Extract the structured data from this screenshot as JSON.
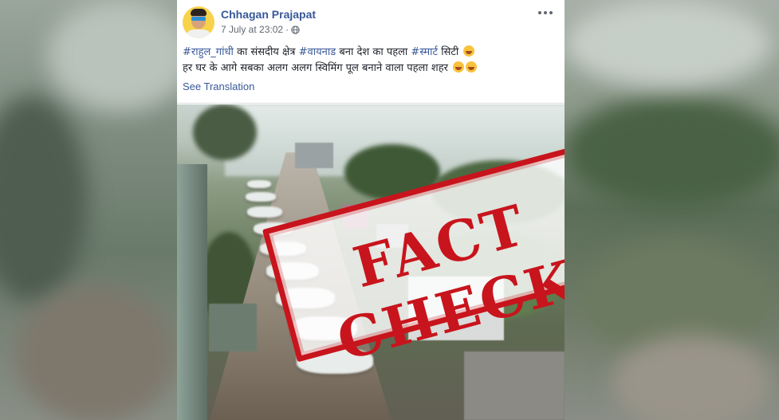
{
  "post": {
    "author": "Chhagan Prajapat",
    "timestamp": "7 July at 23:02",
    "text": {
      "tag1": "#राहुल_गांधी",
      "segment1": " का संसदीय क्षेत्र ",
      "tag2": "#वायनाड",
      "segment2": " बना देश का पहला ",
      "tag3": "#स्मार्ट",
      "segment3": " सिटी",
      "line2": "हर घर के आगे सबका अलग अलग स्विमिंग पूल बनाने वाला पहला शहर"
    },
    "see_translation": "See Translation",
    "icons": {
      "privacy": "globe-icon",
      "options": "more-options-icon",
      "emoji1": "smiling-face-emoji",
      "emoji2": "laughing-emoji"
    }
  },
  "stamp": {
    "label": "FACT CHECK",
    "color": "#c8141c"
  },
  "colors": {
    "link": "#385898",
    "text": "#1d2129",
    "meta": "#616770"
  }
}
